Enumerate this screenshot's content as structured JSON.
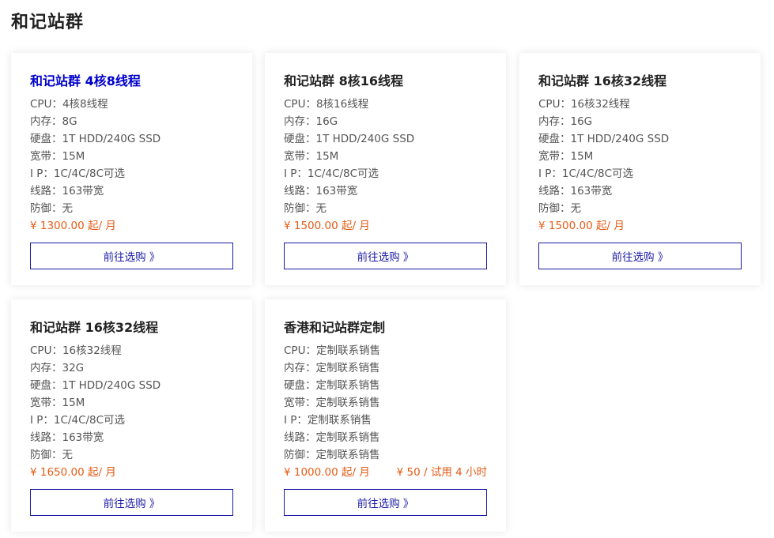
{
  "page": {
    "title": "和记站群"
  },
  "cards": [
    {
      "title": "和记站群 4核8线程",
      "specs": [
        "CPU：4核8线程",
        "内存：8G",
        "硬盘：1T HDD/240G SSD",
        "宽带：15M",
        "I P：1C/4C/8C可选",
        "线路：163带宽",
        "防御：无"
      ],
      "price": "¥ 1300.00 起/ 月",
      "trial": "",
      "button": "前往选购 》"
    },
    {
      "title": "和记站群 8核16线程",
      "specs": [
        "CPU：8核16线程",
        "内存：16G",
        "硬盘：1T HDD/240G SSD",
        "宽带：15M",
        "I P：1C/4C/8C可选",
        "线路：163带宽",
        "防御：无"
      ],
      "price": "¥ 1500.00 起/ 月",
      "trial": "",
      "button": "前往选购 》"
    },
    {
      "title": "和记站群 16核32线程",
      "specs": [
        "CPU：16核32线程",
        "内存：16G",
        "硬盘：1T HDD/240G SSD",
        "宽带：15M",
        "I P：1C/4C/8C可选",
        "线路：163带宽",
        "防御：无"
      ],
      "price": "¥ 1500.00 起/ 月",
      "trial": "",
      "button": "前往选购 》"
    },
    {
      "title": "和记站群 16核32线程",
      "specs": [
        "CPU：16核32线程",
        "内存：32G",
        "硬盘：1T HDD/240G SSD",
        "宽带：15M",
        "I P：1C/4C/8C可选",
        "线路：163带宽",
        "防御：无"
      ],
      "price": "¥ 1650.00 起/ 月",
      "trial": "",
      "button": "前往选购 》"
    },
    {
      "title": "香港和记站群定制",
      "specs": [
        "CPU：定制联系销售",
        "内存：定制联系销售",
        "硬盘：定制联系销售",
        "宽带：定制联系销售",
        "I P：定制联系销售",
        "线路：定制联系销售",
        "防御：定制联系销售"
      ],
      "price": "¥ 1000.00 起/ 月",
      "trial": "¥ 50 / 试用 4 小时",
      "button": "前往选购 》"
    }
  ],
  "colors": {
    "price": "#e85a14",
    "button_border": "#1a1aa6",
    "active_title": "#0000cc"
  }
}
